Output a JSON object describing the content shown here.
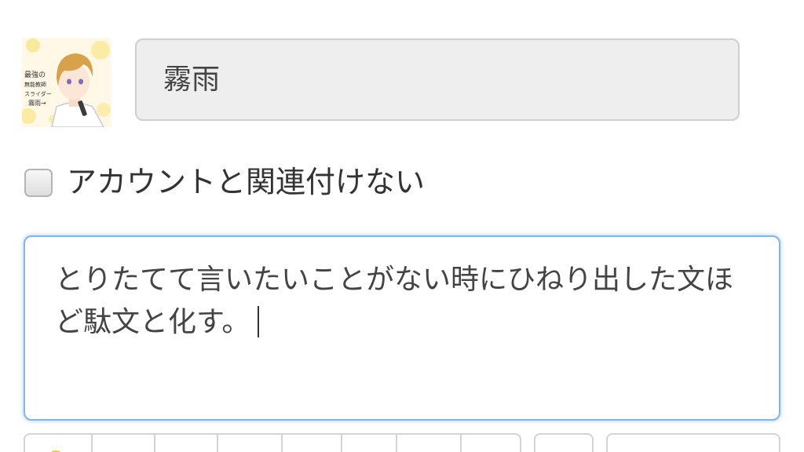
{
  "post_form": {
    "avatar": {
      "alt_icon": "user-avatar-illustration",
      "caption_lines": [
        "最強の",
        "無能教師",
        "スライダー",
        "霧雨→"
      ]
    },
    "name_field": {
      "value": "霧雨"
    },
    "anonymous_option": {
      "label": "アカウントと関連付けない",
      "checked": false
    },
    "message": {
      "value": "とりたてて言いたいことがない時にひねり出した文ほど駄文と化す。"
    },
    "toolbar": {
      "emoji_icon": "emoji-icon"
    }
  },
  "colors": {
    "focus_border": "#7fb7ea",
    "field_background": "#eeeeee",
    "emoji_accent": "#f4c63d"
  }
}
